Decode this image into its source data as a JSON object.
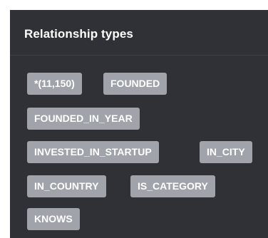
{
  "panel": {
    "title": "Relationship types"
  },
  "relationship_types": [
    "*(11,150)",
    "FOUNDED",
    "FOUNDED_IN_YEAR",
    "INVESTED_IN_STARTUP",
    "IN_CITY",
    "IN_COUNTRY",
    "IS_CATEGORY",
    "KNOWS"
  ],
  "colors": {
    "panel_background": "#2f3136",
    "tag_background": "#a0a3aa",
    "tag_text": "#ffffff",
    "title_text": "#ffffff"
  }
}
